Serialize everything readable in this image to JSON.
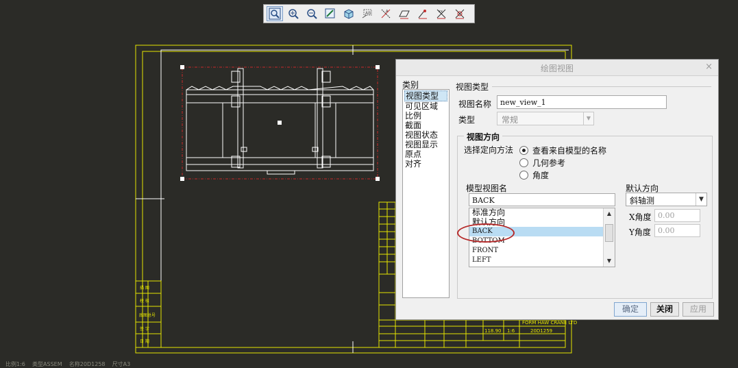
{
  "toolbar": {
    "icons": [
      "zoom-fit-icon",
      "zoom-in-icon",
      "zoom-out-icon",
      "repaint-icon",
      "view-orient-icon",
      "annotation-icon",
      "datum-axis-icon",
      "datum-plane-icon",
      "datum-point-icon",
      "csys-icon",
      "show-hide-icon"
    ]
  },
  "status_bar": "比例1:6    类型ASSEM    名称20D1258    尺寸A3",
  "title_block": {
    "rows_left": [
      "描 图",
      "校 核",
      "底图总号",
      "签 字",
      "日 期"
    ],
    "company": "FORM HAW CRANE LTD",
    "mass": "118.90",
    "scale": "1:6",
    "drawing_no": "20D1259"
  },
  "dialog": {
    "title": "绘图视图",
    "close_label": "×",
    "category_label": "类别",
    "categories": [
      "视图类型",
      "可见区域",
      "比例",
      "截面",
      "视图状态",
      "视图显示",
      "原点",
      "对齐"
    ],
    "selected_category": "视图类型",
    "section_title": "视图类型",
    "view_name_label": "视图名称",
    "view_name_value": "new_view_1",
    "type_label": "类型",
    "type_value": "常规",
    "orientation_group": "视图方向",
    "select_method_label": "选择定向方法",
    "methods": [
      "查看来自模型的名称",
      "几何参考",
      "角度"
    ],
    "selected_method": "查看来自模型的名称",
    "model_view_label": "模型视图名",
    "model_view_value": "BACK",
    "view_list": [
      "标准方向",
      "默认方向",
      "BACK",
      "BOTTOM",
      "FRONT",
      "LEFT"
    ],
    "selected_view": "BACK",
    "default_dir_label": "默认方向",
    "default_dir_value": "斜轴测",
    "x_angle_label": "X角度",
    "x_angle_value": "0.00",
    "y_angle_label": "Y角度",
    "y_angle_value": "0.00",
    "ok_label": "确定",
    "close_button_label": "关闭",
    "apply_label": "应用"
  },
  "colors": {
    "background": "#2b2b27",
    "frame": "#e6e600",
    "geometry": "#ffffff",
    "selection": "#c42a2a",
    "annotation": "#b62a2a"
  }
}
